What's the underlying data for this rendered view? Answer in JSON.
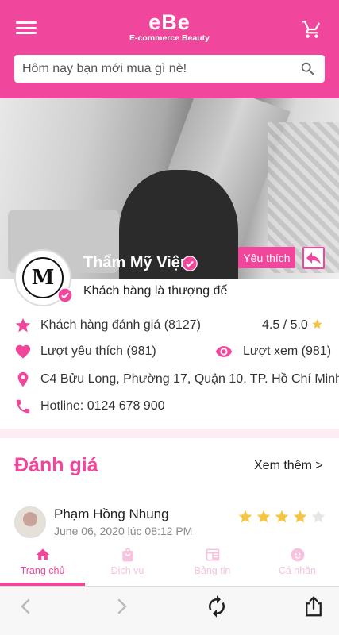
{
  "app": {
    "brand": "eBe",
    "tagline": "E-commerce Beauty"
  },
  "search": {
    "placeholder": "Hôm nay bạn mới mua gì nè!"
  },
  "shop": {
    "name": "Thẩm Mỹ Viện",
    "favorite_label": "Yêu thích",
    "slogan": "Khách hàng là thượng đế",
    "rating_label": "Khách hàng đánh giá (8127)",
    "rating_score": "4.5 / 5.0",
    "likes_label": "Lượt yêu thích (981)",
    "views_label": "Lượt xem (981)",
    "address": "C4 Bửu Long, Phường 17, Quận 10, TP. Hồ Chí Minh",
    "hotline": "Hotline: 0124 678 900"
  },
  "reviews": {
    "title": "Đánh giá",
    "see_more": "Xem thêm >",
    "items": [
      {
        "name": "Phạm Hồng Nhung",
        "date": "June 06, 2020 lúc 08:12 PM",
        "stars": 4,
        "max_stars": 5
      }
    ]
  },
  "tabs": [
    {
      "label": "Trang chủ",
      "icon": "home-icon",
      "active": true
    },
    {
      "label": "Dịch vụ",
      "icon": "bag-icon",
      "active": false
    },
    {
      "label": "Bảng tin",
      "icon": "news-icon",
      "active": false
    },
    {
      "label": "Cá nhân",
      "icon": "face-icon",
      "active": false
    }
  ],
  "colors": {
    "accent": "#f0469b",
    "inactive_tab": "#f7c2dd",
    "star": "#f5c542"
  }
}
